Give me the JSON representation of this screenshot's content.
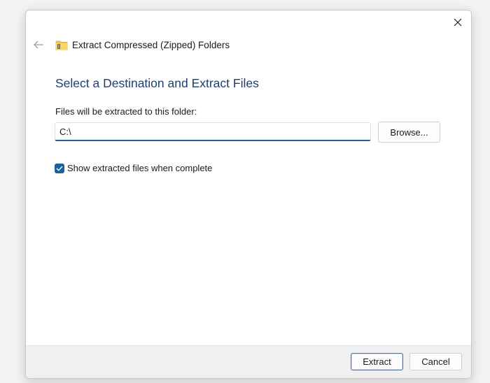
{
  "window": {
    "title": "Extract Compressed (Zipped) Folders",
    "icon": "zip-folder-icon"
  },
  "controls": {
    "back_icon": "arrow-left-icon",
    "close_icon": "close-icon"
  },
  "main": {
    "heading": "Select a Destination and Extract Files",
    "destination_label": "Files will be extracted to this folder:",
    "destination_value": "C:\\",
    "browse_label": "Browse...",
    "show_files_label": "Show extracted files when complete",
    "show_files_checked": true
  },
  "footer": {
    "extract_label": "Extract",
    "cancel_label": "Cancel"
  },
  "colors": {
    "accent": "#1f5f9e",
    "heading": "#1e3f6d",
    "footer_bg": "#f0f0f0"
  }
}
